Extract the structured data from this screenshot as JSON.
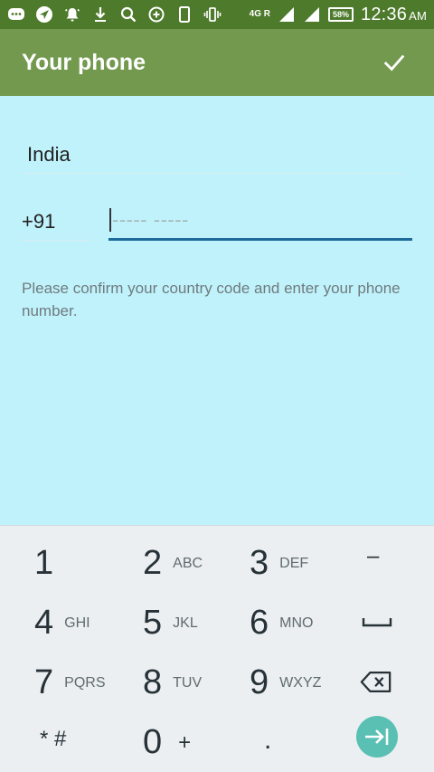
{
  "status_bar": {
    "network_label": "4G R",
    "battery": "58%",
    "time": "12:36",
    "ampm": "AM"
  },
  "app_bar": {
    "title": "Your phone"
  },
  "form": {
    "country": "India",
    "country_code": "+91",
    "phone_placeholder": "----- -----",
    "hint": "Please confirm your country code and enter your phone number."
  },
  "keypad": {
    "keys": [
      {
        "digit": "1",
        "letters": ""
      },
      {
        "digit": "2",
        "letters": "ABC"
      },
      {
        "digit": "3",
        "letters": "DEF"
      },
      {
        "digit": "4",
        "letters": "GHI"
      },
      {
        "digit": "5",
        "letters": "JKL"
      },
      {
        "digit": "6",
        "letters": "MNO"
      },
      {
        "digit": "7",
        "letters": "PQRS"
      },
      {
        "digit": "8",
        "letters": "TUV"
      },
      {
        "digit": "9",
        "letters": "WXYZ"
      },
      {
        "digit": "0",
        "letters": "+"
      }
    ],
    "star_hash": "* #",
    "dash": "–",
    "dot": "."
  },
  "colors": {
    "status_bar": "#4e7a2c",
    "app_bar": "#72994e",
    "background": "#c0f2fb",
    "accent": "#1e6a9a",
    "next_button": "#59c0b3"
  }
}
